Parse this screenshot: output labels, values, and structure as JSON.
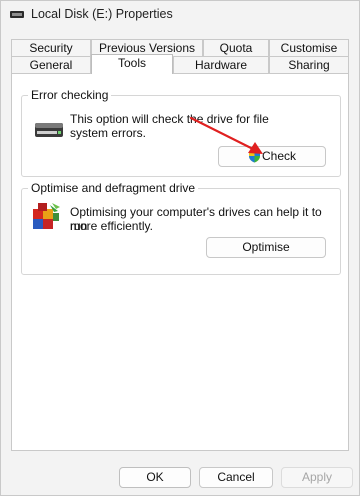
{
  "window": {
    "title": "Local Disk (E:) Properties"
  },
  "tabs": {
    "row1": [
      "Security",
      "Previous Versions",
      "Quota",
      "Customise"
    ],
    "row2": [
      "General",
      "Tools",
      "Hardware",
      "Sharing"
    ],
    "active": "Tools"
  },
  "error_checking": {
    "heading": "Error checking",
    "description_line1": "This option will check the drive for file",
    "description_line2": "system errors.",
    "button_label": "Check",
    "icon": "drive-icon"
  },
  "optimise": {
    "heading": "Optimise and defragment drive",
    "description_line1": "Optimising your computer's drives can help it to run",
    "description_line2": "more efficiently.",
    "button_label": "Optimise",
    "icon": "defrag-icon"
  },
  "footer": {
    "ok_label": "OK",
    "cancel_label": "Cancel",
    "apply_label": "Apply"
  },
  "colors": {
    "annotation_arrow": "#e02020",
    "accent": "#0067c0"
  }
}
